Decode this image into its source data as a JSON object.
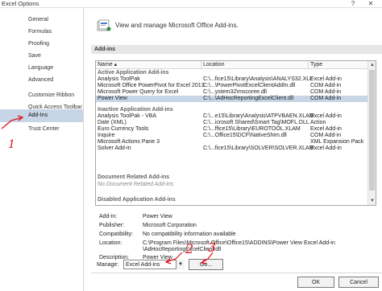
{
  "window": {
    "title": "Excel Options",
    "help_glyph": "?",
    "close_glyph": "✕"
  },
  "sidebar": {
    "items": [
      {
        "label": "General"
      },
      {
        "label": "Formulas"
      },
      {
        "label": "Proofing"
      },
      {
        "label": "Save"
      },
      {
        "label": "Language"
      },
      {
        "label": "Advanced"
      },
      {
        "label": "Customize Ribbon"
      },
      {
        "label": "Quick Access Toolbar"
      },
      {
        "label": "Add-Ins",
        "active": true
      },
      {
        "label": "Trust Center"
      }
    ]
  },
  "header": {
    "text": "View and manage Microsoft Office Add-ins."
  },
  "section": {
    "title": "Add-ins"
  },
  "list": {
    "columns": {
      "name": "Name ▴",
      "location": "Location",
      "type": "Type"
    },
    "groups": [
      {
        "title": "Active Application Add-ins",
        "rows": [
          {
            "name": "Analysis ToolPak",
            "location": "C:\\...fice15\\Library\\Analysis\\ANALYS32.XLL",
            "type": "Excel Add-in"
          },
          {
            "name": "Microsoft Office PowerPivot for Excel 2013",
            "location": "C:\\...\\PowerPivotExcelClientAddIn.dll",
            "type": "COM Add-in"
          },
          {
            "name": "Microsoft Power Query for Excel",
            "location": "C:\\...ystem32\\mscoree.dll",
            "type": "COM Add-in"
          },
          {
            "name": "Power View",
            "location": "C:\\...\\AdHocReportingExcelClient.dll",
            "type": "COM Add-in",
            "selected": true
          }
        ]
      },
      {
        "title": "Inactive Application Add-ins",
        "rows": [
          {
            "name": "Analysis ToolPak - VBA",
            "location": "C:\\...e15\\Library\\Analysis\\ATPVBAEN.XLAM",
            "type": "Excel Add-in"
          },
          {
            "name": "Date (XML)",
            "location": "C:\\...icrosoft Shared\\Smart Tag\\MOFL.DLL",
            "type": "Action"
          },
          {
            "name": "Euro Currency Tools",
            "location": "C:\\...ffice15\\Library\\EUROTOOL.XLAM",
            "type": "Excel Add-in"
          },
          {
            "name": "Inquire",
            "location": "C:\\...Office15\\DCF\\NativeShim.dll",
            "type": "COM Add-in"
          },
          {
            "name": "Microsoft Actions Pane 3",
            "location": "",
            "type": "XML Expansion Pack"
          },
          {
            "name": "Solver Add-in",
            "location": "C:\\...fice15\\Library\\SOLVER\\SOLVER.XLAM",
            "type": "Excel Add-in"
          }
        ]
      },
      {
        "title": "Document Related Add-ins",
        "empty": "No Document Related Add-ins",
        "rows": []
      },
      {
        "title": "Disabled Application Add-ins",
        "rows": []
      }
    ]
  },
  "details": {
    "addin": {
      "label": "Add-in:",
      "value": "Power View"
    },
    "publisher": {
      "label": "Publisher:",
      "value": "Microsoft Corporation"
    },
    "compat": {
      "label": "Compatibility:",
      "value": "No compatibility information available"
    },
    "location": {
      "label": "Location:",
      "value1": "C:\\Program Files\\Microsoft Office\\Office15\\ADDINS\\Power View Excel Add-in",
      "value2": "\\AdHocReportingExcelClient.dll"
    },
    "description": {
      "label": "Description:",
      "value": "Power View"
    }
  },
  "manage": {
    "label": "Manage:",
    "selected": "Excel Add-ins",
    "go_label": "Go..."
  },
  "footer": {
    "ok": "OK",
    "cancel": "Cancel"
  },
  "annotations": {
    "one": "1",
    "two": "2",
    "three": "3"
  },
  "colors": {
    "annotation": "#e0141e",
    "selection": "#c7d6e6"
  }
}
